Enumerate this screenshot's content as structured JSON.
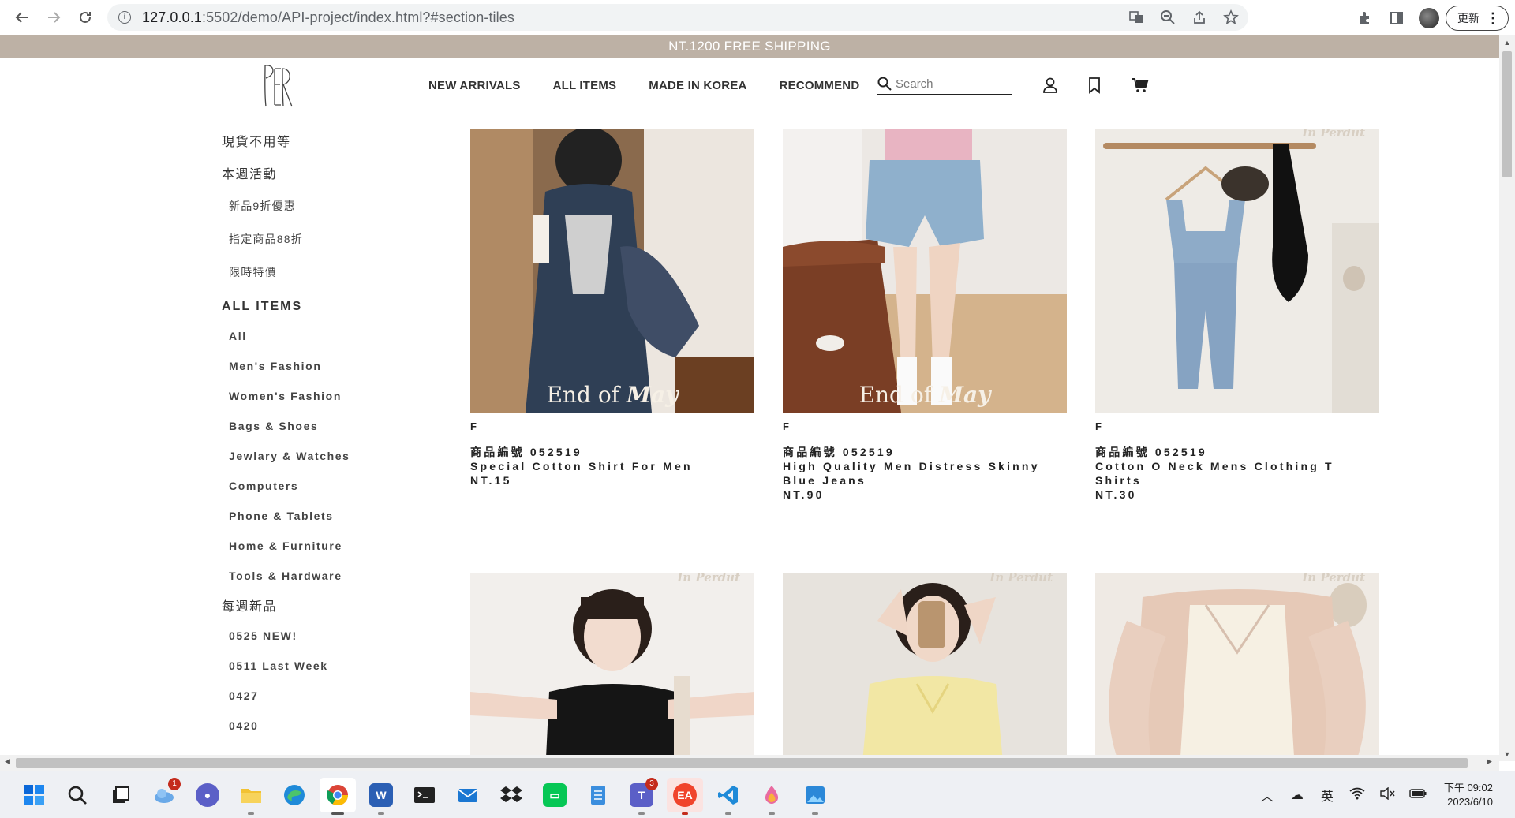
{
  "browser": {
    "url_host": "127.0.0.1",
    "url_path": ":5502/demo/API-project/index.html?#section-tiles",
    "update_label": "更新",
    "kebab": "⋮",
    "info_glyph": "i"
  },
  "site": {
    "promo": "NT.1200 FREE SHIPPING",
    "nav": [
      "NEW ARRIVALS",
      "ALL ITEMS",
      "MADE IN KOREA",
      "RECOMMEND"
    ],
    "search_placeholder": "Search"
  },
  "sidebar": {
    "cat1": "現貨不用等",
    "cat2": "本週活動",
    "cat2_items": [
      "新品9折優惠",
      "指定商品88折",
      "限時特價"
    ],
    "cat3": "ALL ITEMS",
    "cat3_items": [
      "All",
      "Men's Fashion",
      "Women's Fashion",
      "Bags & Shoes",
      "Jewlary & Watches",
      "Computers",
      "Phone & Tablets",
      "Home & Furniture",
      "Tools & Hardware"
    ],
    "cat4": "每週新品",
    "cat4_items": [
      "0525 NEW!",
      "0511 Last Week",
      "0427",
      "0420"
    ]
  },
  "products": [
    {
      "size": "F",
      "code": "商品編號 052519",
      "name": "Special Cotton Shirt For Men",
      "price": "NT.15",
      "overlay_a": "End of ",
      "overlay_b": "May",
      "watermark": ""
    },
    {
      "size": "F",
      "code": "商品編號 052519",
      "name": "High Quality Men Distress Skinny Blue Jeans",
      "price": "NT.90",
      "overlay_a": "End of ",
      "overlay_b": "May",
      "watermark": ""
    },
    {
      "size": "F",
      "code": "商品編號 052519",
      "name": "Cotton O Neck Mens Clothing T Shirts",
      "price": "NT.30",
      "overlay_a": "",
      "overlay_b": "",
      "watermark": "In Perdut"
    },
    {
      "size": "",
      "code": "",
      "name": "",
      "price": "",
      "overlay_a": "",
      "overlay_b": "",
      "watermark": "In Perdut"
    },
    {
      "size": "",
      "code": "",
      "name": "",
      "price": "",
      "overlay_a": "",
      "overlay_b": "",
      "watermark": "In Perdut"
    },
    {
      "size": "",
      "code": "",
      "name": "",
      "price": "",
      "overlay_a": "",
      "overlay_b": "",
      "watermark": "In Perdut"
    }
  ],
  "taskbar": {
    "badge_weather": "1",
    "badge_teams": "3",
    "app_w": "W",
    "app_ea": "EA",
    "ime": "英",
    "time": "下午 09:02",
    "date": "2023/6/10"
  }
}
